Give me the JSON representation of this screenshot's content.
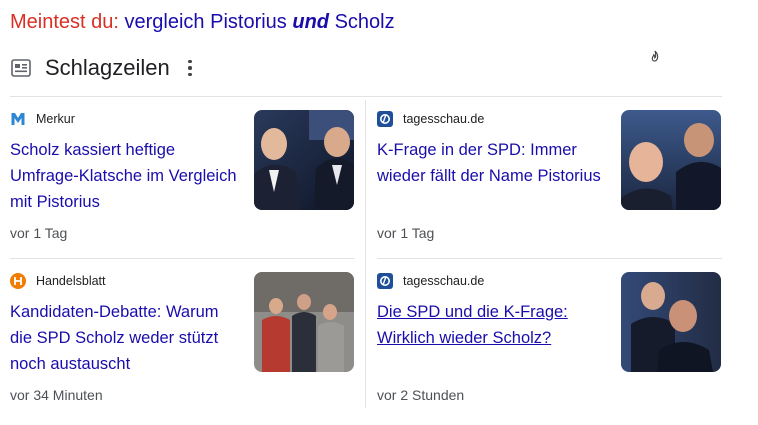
{
  "did_you_mean": {
    "prefix": "Meintest du:",
    "query_part1": "vergleich Pistorius",
    "query_emphasis": "und",
    "query_part2": "Scholz"
  },
  "section": {
    "title": "Schlagzeilen",
    "icon": "news-icon",
    "menu_icon": "more-vert-icon"
  },
  "cards": [
    {
      "source": "Merkur",
      "source_icon": "merkur-logo",
      "source_color": "#2f86d6",
      "headline": "Scholz kassiert heftige Umfrage-Klatsche im Vergleich mit Pistorius",
      "time": "vor 1 Tag"
    },
    {
      "source": "tagesschau.de",
      "source_icon": "tagesschau-logo",
      "source_color": "#1f4f9a",
      "headline": "K-Frage in der SPD: Immer wieder fällt der Name Pistorius",
      "time": "vor 1 Tag"
    },
    {
      "source": "Handelsblatt",
      "source_icon": "handelsblatt-logo",
      "source_color": "#f07c00",
      "headline": "Kandidaten-Debatte: Warum die SPD Scholz weder stützt noch austauscht",
      "time": "vor 34 Minuten"
    },
    {
      "source": "tagesschau.de",
      "source_icon": "tagesschau-logo",
      "source_color": "#1f4f9a",
      "headline": "Die SPD und die K-Frage: Wirklich wieder Scholz?",
      "time": "vor 2 Stunden"
    }
  ],
  "colors": {
    "link": "#1a0dab",
    "did_you_mean_prefix": "#d93025",
    "meta_text": "#4d5156"
  }
}
